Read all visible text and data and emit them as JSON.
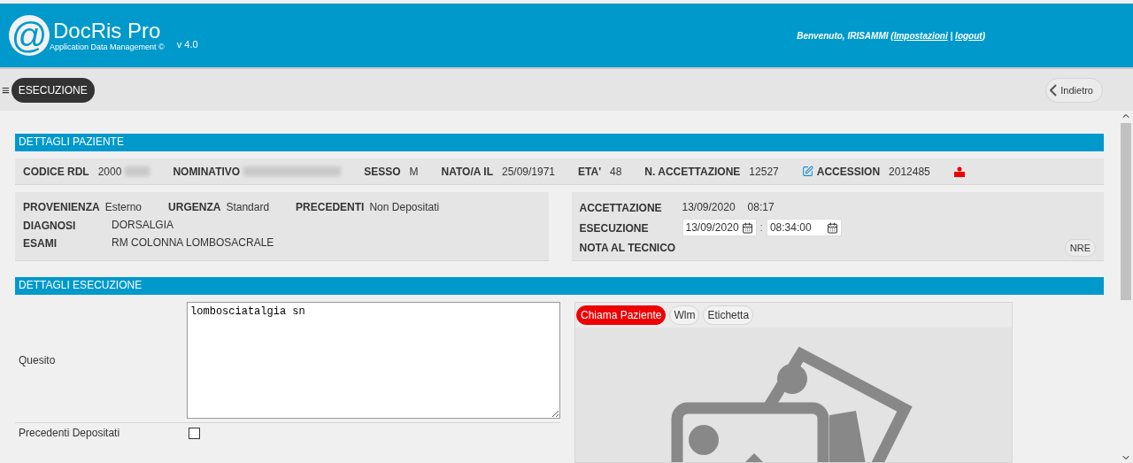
{
  "header": {
    "logo_mark": "@",
    "app_name": "DocRis Pro",
    "tagline": "Application Data Management ©",
    "version": "v 4.0",
    "welcome": "Benvenuto, IRISAMMI (",
    "settings_link": "Impostazioni",
    "separator": " | ",
    "logout_link": "logout",
    "welcome_end": ")"
  },
  "toolbar": {
    "menu_glyph": "≡",
    "page_button": "ESECUZIONE",
    "back_button": "Indietro"
  },
  "patient": {
    "title": "DETTAGLI PAZIENTE",
    "fields": [
      {
        "label": "CODICE RDL",
        "value": "2000",
        "redacted": true
      },
      {
        "label": "NOMINATIVO",
        "redacted": true
      },
      {
        "label": "SESSO",
        "value": "M"
      },
      {
        "label": "NATO/A IL",
        "value": "25/09/1971"
      },
      {
        "label": "ETA'",
        "value": "48"
      },
      {
        "label": "N. ACCETTAZIONE",
        "value": "12527"
      },
      {
        "label": "ACCESSION",
        "value": "2012485",
        "edit_icon": true
      }
    ],
    "left_box": {
      "row1": [
        {
          "label": "PROVENIENZA",
          "value": "Esterno"
        },
        {
          "label": "URGENZA",
          "value": "Standard"
        },
        {
          "label": "PRECEDENTI",
          "value": "Non Depositati"
        }
      ],
      "rows": [
        {
          "label": "DIAGNOSI",
          "value": "DORSALGIA"
        },
        {
          "label": "ESAMI",
          "value": "RM COLONNA LOMBOSACRALE"
        }
      ]
    },
    "right_box": {
      "accettazione_label": "ACCETTAZIONE",
      "accettazione_date": "13/09/2020",
      "accettazione_time": "08:17",
      "esecuzione_label": "ESECUZIONE",
      "esecuzione_date": "13/09/2020",
      "time_separator": ":",
      "esecuzione_time": "08:34:00",
      "nota_label": "NOTA AL TECNICO",
      "nre_button": "NRE"
    }
  },
  "execution": {
    "title": "DETTAGLI ESECUZIONE",
    "quesito_label": "Quesito",
    "quesito_value": "lombosciatalgia sn",
    "precedenti_label": "Precedenti Depositati",
    "precedenti_checked": false,
    "actions": [
      {
        "label": "Chiama Paziente",
        "kind": "alert"
      },
      {
        "label": "Wlm",
        "kind": "plain"
      },
      {
        "label": "Etichetta",
        "kind": "plain"
      }
    ]
  }
}
